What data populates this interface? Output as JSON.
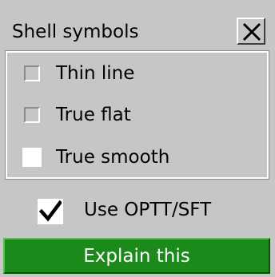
{
  "window": {
    "title": "Shell symbols",
    "close_icon": "close-x-icon"
  },
  "options": [
    {
      "label": "Thin line",
      "state": "unselected-greyed"
    },
    {
      "label": "True flat",
      "state": "unselected-greyed"
    },
    {
      "label": "True smooth",
      "state": "unselected-white"
    }
  ],
  "use_optt": {
    "label": "Use OPTT/SFT",
    "checked": true
  },
  "explain": {
    "label": "Explain this"
  },
  "colors": {
    "panel": "#c6c6c6",
    "explain_button": "#1b8a1b",
    "explain_text": "#ffffff"
  }
}
